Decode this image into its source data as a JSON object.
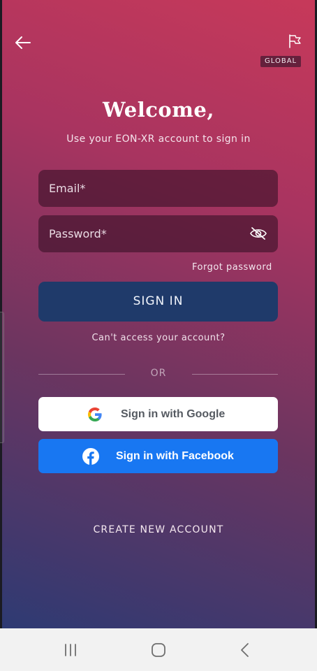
{
  "header": {
    "back_icon": "arrow-left-icon",
    "flag_icon": "flag-icon",
    "region_label": "GLOBAL"
  },
  "welcome": {
    "title": "Welcome,",
    "subtitle": "Use your EON-XR account to sign in"
  },
  "form": {
    "email_placeholder": "Email*",
    "password_placeholder": "Password*",
    "password_toggle_icon": "eye-off-icon",
    "forgot_label": "Forgot password",
    "signin_label": "SIGN IN",
    "cant_access_label": "Can't access your account?"
  },
  "divider": {
    "label": "OR"
  },
  "social": {
    "google_label": "Sign in with Google",
    "google_icon": "google-icon",
    "facebook_label": "Sign in with Facebook",
    "facebook_icon": "facebook-icon"
  },
  "create_account_label": "CREATE NEW ACCOUNT",
  "navbar": {
    "recents_icon": "recent-apps-icon",
    "home_icon": "home-icon",
    "back_icon": "back-chevron-icon"
  },
  "colors": {
    "gradient_top": "#c7395a",
    "gradient_bottom": "#2e3a73",
    "signin_button": "#1f3a6a",
    "facebook_blue": "#1877f2",
    "navbar_bg": "#f2f2f2"
  }
}
